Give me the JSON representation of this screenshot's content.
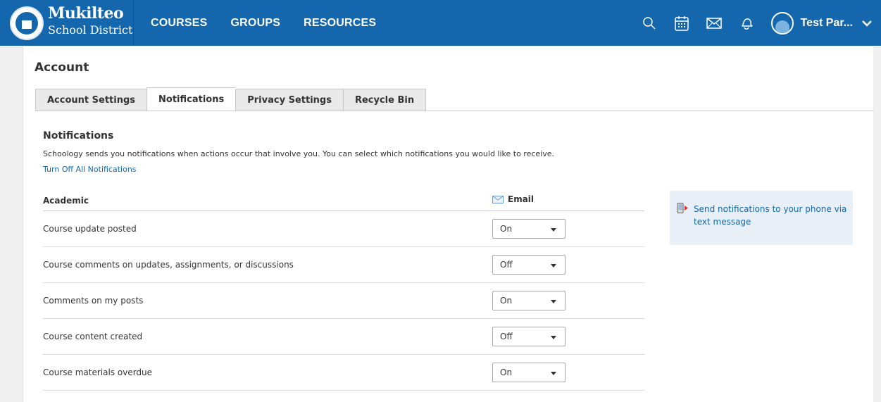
{
  "logo": {
    "line1": "Mukilteo",
    "line2": "School District"
  },
  "nav": {
    "items": [
      "COURSES",
      "GROUPS",
      "RESOURCES"
    ]
  },
  "header_icons": [
    "search-icon",
    "calendar-icon",
    "mail-icon",
    "bell-icon"
  ],
  "user": {
    "name": "Test Par..."
  },
  "account": {
    "title": "Account",
    "tabs": [
      {
        "label": "Account Settings",
        "active": false
      },
      {
        "label": "Notifications",
        "active": true
      },
      {
        "label": "Privacy Settings",
        "active": false
      },
      {
        "label": "Recycle Bin",
        "active": false
      }
    ]
  },
  "notifications": {
    "title": "Notifications",
    "description": "Schoology sends you notifications when actions occur that involve you. You can select which notifications you would like to receive.",
    "turn_off_link": "Turn Off All Notifications",
    "section_label": "Academic",
    "email_header": "Email",
    "rows": [
      {
        "label": "Course update posted",
        "value": "On"
      },
      {
        "label": "Course comments on updates, assignments, or discussions",
        "value": "Off"
      },
      {
        "label": "Comments on my posts",
        "value": "On"
      },
      {
        "label": "Course content created",
        "value": "Off"
      },
      {
        "label": "Course materials overdue",
        "value": "On"
      }
    ]
  },
  "sidebar": {
    "text_message_link": "Send notifications to your phone via text message"
  },
  "colors": {
    "brand_blue": "#1467ad",
    "link_blue": "#1467ad",
    "side_box_bg": "#e8eff7"
  }
}
